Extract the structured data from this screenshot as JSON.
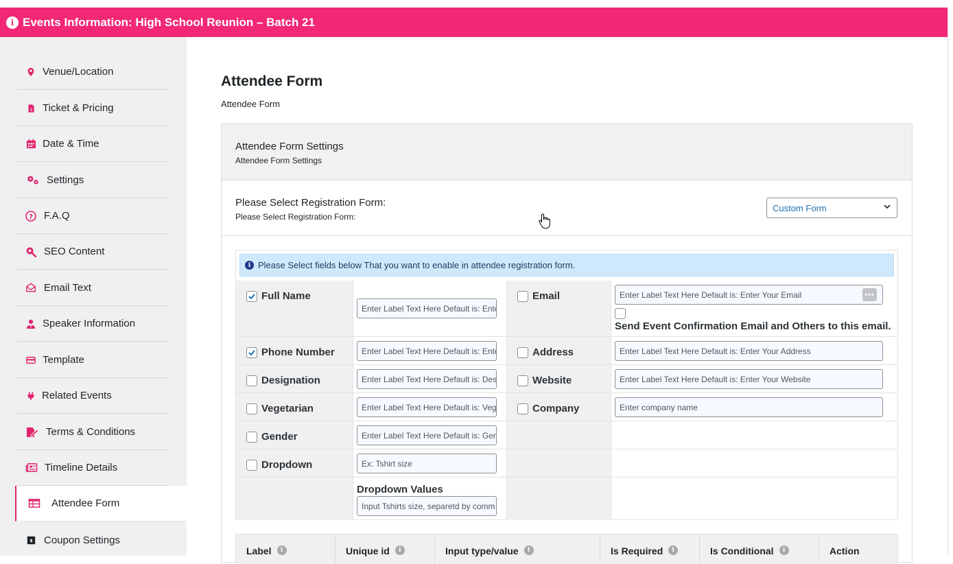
{
  "header": {
    "title": "Events Information: High School Reunion – Batch 21",
    "info_icon": "info-icon",
    "color": "#f22876"
  },
  "sidebar": {
    "items": [
      {
        "label": "Venue/Location",
        "icon": "map-pin-icon"
      },
      {
        "label": "Ticket & Pricing",
        "icon": "ticket-file-icon"
      },
      {
        "label": "Date & Time",
        "icon": "calendar-icon"
      },
      {
        "label": "Settings",
        "icon": "gears-icon"
      },
      {
        "label": "F.A.Q",
        "icon": "question-circle-icon"
      },
      {
        "label": "SEO Content",
        "icon": "search-icon"
      },
      {
        "label": "Email Text",
        "icon": "envelope-icon"
      },
      {
        "label": "Speaker Information",
        "icon": "user-tie-icon"
      },
      {
        "label": "Template",
        "icon": "card-icon"
      },
      {
        "label": "Related Events",
        "icon": "plug-icon"
      },
      {
        "label": "Terms & Conditions",
        "icon": "file-signature-icon"
      },
      {
        "label": "Timeline Details",
        "icon": "newspaper-icon"
      },
      {
        "label": "Attendee Form",
        "icon": "table-icon",
        "active": true
      },
      {
        "label": "Coupon Settings",
        "icon": "coupon-icon"
      }
    ],
    "accent": "#e0246e"
  },
  "main": {
    "title": "Attendee Form",
    "subtitle": "Attendee Form",
    "panel": {
      "heading": "Attendee Form Settings",
      "subheading": "Attendee Form Settings",
      "registration": {
        "label": "Please Select Registration Form:",
        "sublabel": "Please Select Registration Form:",
        "selected": "Custom Form"
      },
      "notice": "Please Select fields below That you want to enable in attendee registration form.",
      "fields_left": [
        {
          "label": "Full Name",
          "checked": true,
          "placeholder": "Enter Label Text Here Default is: Enter"
        },
        {
          "label": "Phone Number",
          "checked": true,
          "placeholder": "Enter Label Text Here Default is: Enter"
        },
        {
          "label": "Designation",
          "checked": false,
          "placeholder": "Enter Label Text Here Default is: Desi"
        },
        {
          "label": "Vegetarian",
          "checked": false,
          "placeholder": "Enter Label Text Here Default is: Vege"
        },
        {
          "label": "Gender",
          "checked": false,
          "placeholder": "Enter Label Text Here Default is: Gen"
        },
        {
          "label": "Dropdown",
          "checked": false,
          "placeholder": "Ex: Tshirt size"
        }
      ],
      "dropdown_values": {
        "label": "Dropdown Values",
        "placeholder": "Input Tshirts size, separetd by comm"
      },
      "fields_right": [
        {
          "label": "Email",
          "checked": false,
          "placeholder": "Enter Label Text Here Default is: Enter Your Email"
        },
        {
          "label": "Address",
          "checked": false,
          "placeholder": "Enter Label Text Here Default is: Enter Your Address"
        },
        {
          "label": "Website",
          "checked": false,
          "placeholder": "Enter Label Text Here Default is: Enter Your Website"
        },
        {
          "label": "Company",
          "checked": false,
          "placeholder": "Enter company name"
        }
      ],
      "email_confirm": {
        "label": "Send Event Confirmation Email and Others to this email.",
        "checked": false
      },
      "table_headers": [
        "Label",
        "Unique id",
        "Input type/value",
        "Is Required",
        "Is Conditional",
        "Action"
      ]
    }
  }
}
